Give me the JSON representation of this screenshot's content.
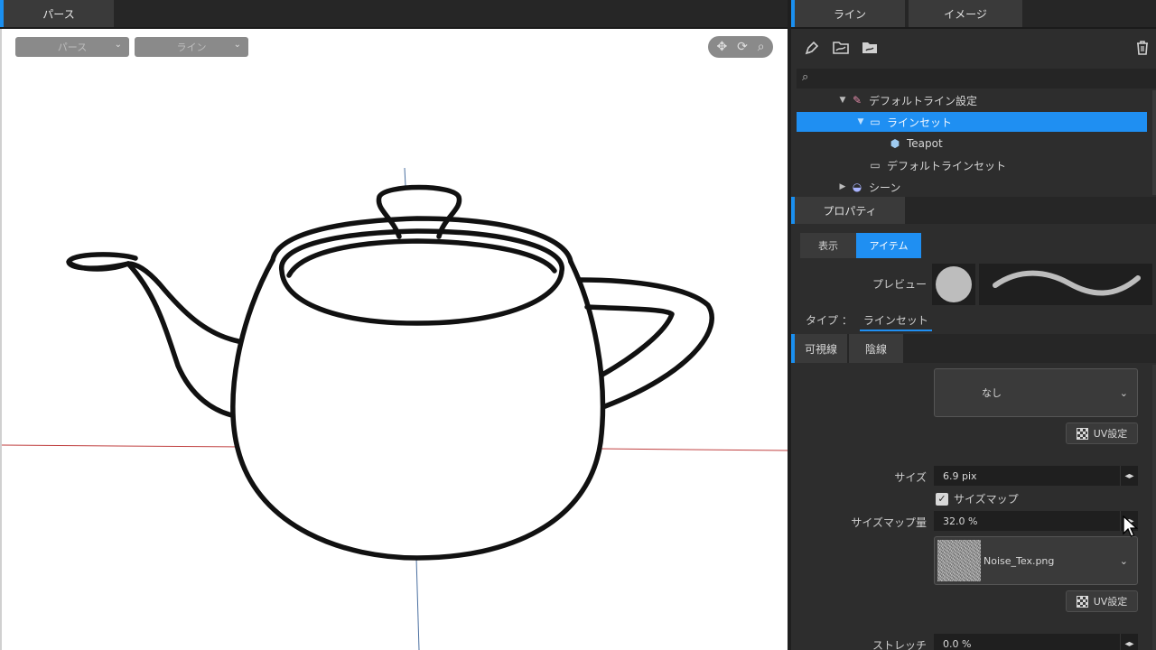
{
  "left_tabs": {
    "perse": "パース"
  },
  "viewport": {
    "dropdown_camera": "パース",
    "dropdown_mode": "ライン",
    "tools": [
      "move-icon",
      "rotate-icon",
      "zoom-icon"
    ]
  },
  "right_tabs": {
    "line": "ライン",
    "image": "イメージ"
  },
  "toolbar_icons": [
    "pen-icon",
    "folder-line-icon",
    "folder-icon",
    "trash-icon"
  ],
  "tree": {
    "items": [
      {
        "label": "デフォルトライン設定",
        "arrow": "▼",
        "icon": "pen-icon"
      },
      {
        "label": "ラインセット",
        "arrow": "▼",
        "icon": "folder-line-icon"
      },
      {
        "label": "Teapot",
        "arrow": "",
        "icon": "cube-icon"
      },
      {
        "label": "デフォルトラインセット",
        "arrow": "",
        "icon": "folder-line-icon"
      },
      {
        "label": "シーン",
        "arrow": "▶",
        "icon": "scene-icon"
      }
    ]
  },
  "properties": {
    "tab": "プロパティ",
    "buttons": {
      "display": "表示",
      "item": "アイテム"
    },
    "preview_label": "プレビュー",
    "type_label": "タイプ ：",
    "type_value": "ラインセット",
    "subtabs": {
      "visible": "可視線",
      "hidden": "陰線"
    },
    "texture_none": "なし",
    "uv_label": "UV設定",
    "size_label": "サイズ",
    "size_value": "6.9 pix",
    "sizemap_checkbox": "サイズマップ",
    "sizemap_amount_label": "サイズマップ量",
    "sizemap_amount_value": "32.0 %",
    "noise_file": "Noise_Tex.png",
    "uv_label_2": "UV設定",
    "stretch_label": "ストレッチ",
    "stretch_value": "0.0 %"
  },
  "colors": {
    "accent": "#1f8ff2",
    "panel": "#2d2d2d",
    "viewport": "#ffffff"
  }
}
